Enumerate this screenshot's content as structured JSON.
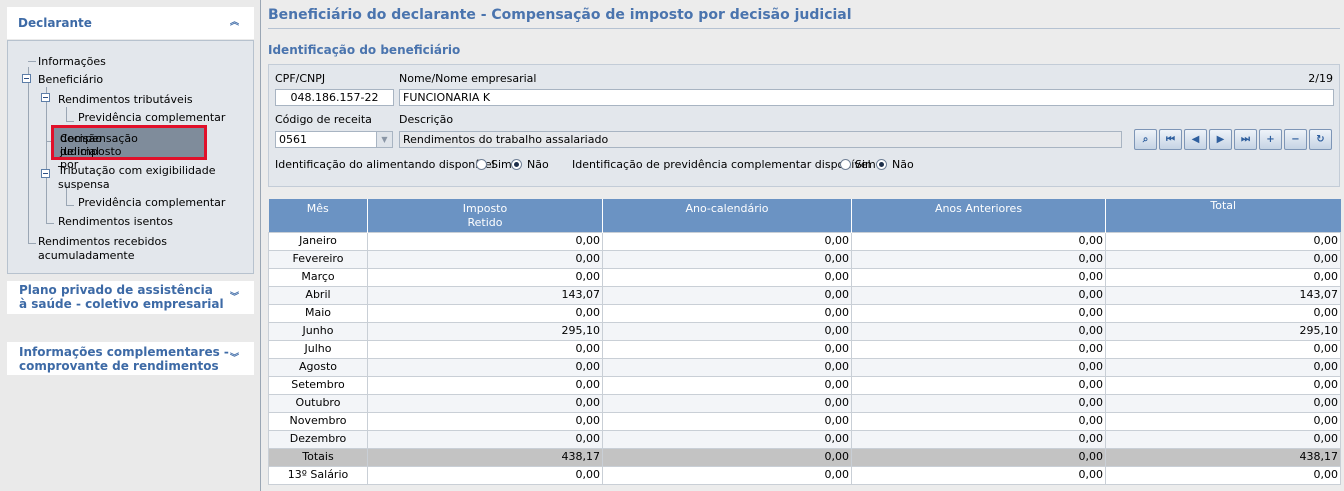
{
  "sidebar": {
    "declarante": {
      "label": "Declarante",
      "chevron": "«"
    },
    "tree": {
      "informacoes": "Informações",
      "beneficiario": "Beneficiário",
      "rend_tributaveis": "Rendimentos tributáveis",
      "prev_comp_1": "Previdência complementar",
      "compensacao_l1": "Compensação de imposto por",
      "compensacao_l2": "decisão judicial",
      "tributacao_l1": "Tributação com exigibilidade",
      "tributacao_l2": "suspensa",
      "prev_comp_2": "Previdência complementar",
      "rend_isentos": "Rendimentos isentos",
      "rend_recebidos_l1": "Rendimentos recebidos",
      "rend_recebidos_l2": "acumuladamente"
    },
    "plano": {
      "line1": "Plano privado de assistência",
      "line2": "à saúde - coletivo empresarial"
    },
    "info_comp": {
      "line1": "Informações complementares -",
      "line2": "comprovante de rendimentos"
    }
  },
  "main": {
    "title": "Beneficiário do declarante - Compensação de imposto por decisão judicial",
    "section_title": "Identificação do beneficiário",
    "form": {
      "cpf_label": "CPF/CNPJ",
      "cpf_value": "048.186.157-22",
      "nome_label": "Nome/Nome empresarial",
      "nome_value": "FUNCIONARIA K",
      "counter": "2/19",
      "codigo_label": "Código de receita",
      "codigo_value": "0561",
      "descricao_label": "Descrição",
      "descricao_value": "Rendimentos do trabalho assalariado",
      "alimentando_label": "Identificação do alimentando disponível",
      "previdencia_label": "Identificação de previdência complementar disponível",
      "sim": "Sim",
      "nao": "Não",
      "alimentando_selected": "Não",
      "previdencia_selected": "Não"
    },
    "nav_buttons": [
      "search-icon",
      "first-record-icon",
      "previous-record-icon",
      "next-record-icon",
      "last-record-icon",
      "add-icon",
      "remove-icon",
      "refresh-icon"
    ]
  },
  "table": {
    "headers": {
      "mes": "Mês",
      "imposto_l1": "Imposto",
      "imposto_l2": "Retido",
      "ano_calendario": "Ano-calendário",
      "anos_anteriores": "Anos Anteriores",
      "total": "Total"
    },
    "rows": [
      {
        "mes": "Janeiro",
        "imposto": "0,00",
        "ano": "0,00",
        "anteriores": "0,00",
        "total": "0,00"
      },
      {
        "mes": "Fevereiro",
        "imposto": "0,00",
        "ano": "0,00",
        "anteriores": "0,00",
        "total": "0,00"
      },
      {
        "mes": "Março",
        "imposto": "0,00",
        "ano": "0,00",
        "anteriores": "0,00",
        "total": "0,00"
      },
      {
        "mes": "Abril",
        "imposto": "143,07",
        "ano": "0,00",
        "anteriores": "0,00",
        "total": "143,07"
      },
      {
        "mes": "Maio",
        "imposto": "0,00",
        "ano": "0,00",
        "anteriores": "0,00",
        "total": "0,00"
      },
      {
        "mes": "Junho",
        "imposto": "295,10",
        "ano": "0,00",
        "anteriores": "0,00",
        "total": "295,10"
      },
      {
        "mes": "Julho",
        "imposto": "0,00",
        "ano": "0,00",
        "anteriores": "0,00",
        "total": "0,00"
      },
      {
        "mes": "Agosto",
        "imposto": "0,00",
        "ano": "0,00",
        "anteriores": "0,00",
        "total": "0,00"
      },
      {
        "mes": "Setembro",
        "imposto": "0,00",
        "ano": "0,00",
        "anteriores": "0,00",
        "total": "0,00"
      },
      {
        "mes": "Outubro",
        "imposto": "0,00",
        "ano": "0,00",
        "anteriores": "0,00",
        "total": "0,00"
      },
      {
        "mes": "Novembro",
        "imposto": "0,00",
        "ano": "0,00",
        "anteriores": "0,00",
        "total": "0,00"
      },
      {
        "mes": "Dezembro",
        "imposto": "0,00",
        "ano": "0,00",
        "anteriores": "0,00",
        "total": "0,00"
      }
    ],
    "totals": {
      "mes": "Totais",
      "imposto": "438,17",
      "ano": "0,00",
      "anteriores": "0,00",
      "total": "438,17"
    },
    "salario13": {
      "mes": "13º Salário",
      "imposto": "0,00",
      "ano": "0,00",
      "anteriores": "0,00",
      "total": "0,00"
    }
  },
  "colors": {
    "accent": "#4a74ae",
    "header_bg": "#6b93c3",
    "selection_border": "#e1102a"
  }
}
